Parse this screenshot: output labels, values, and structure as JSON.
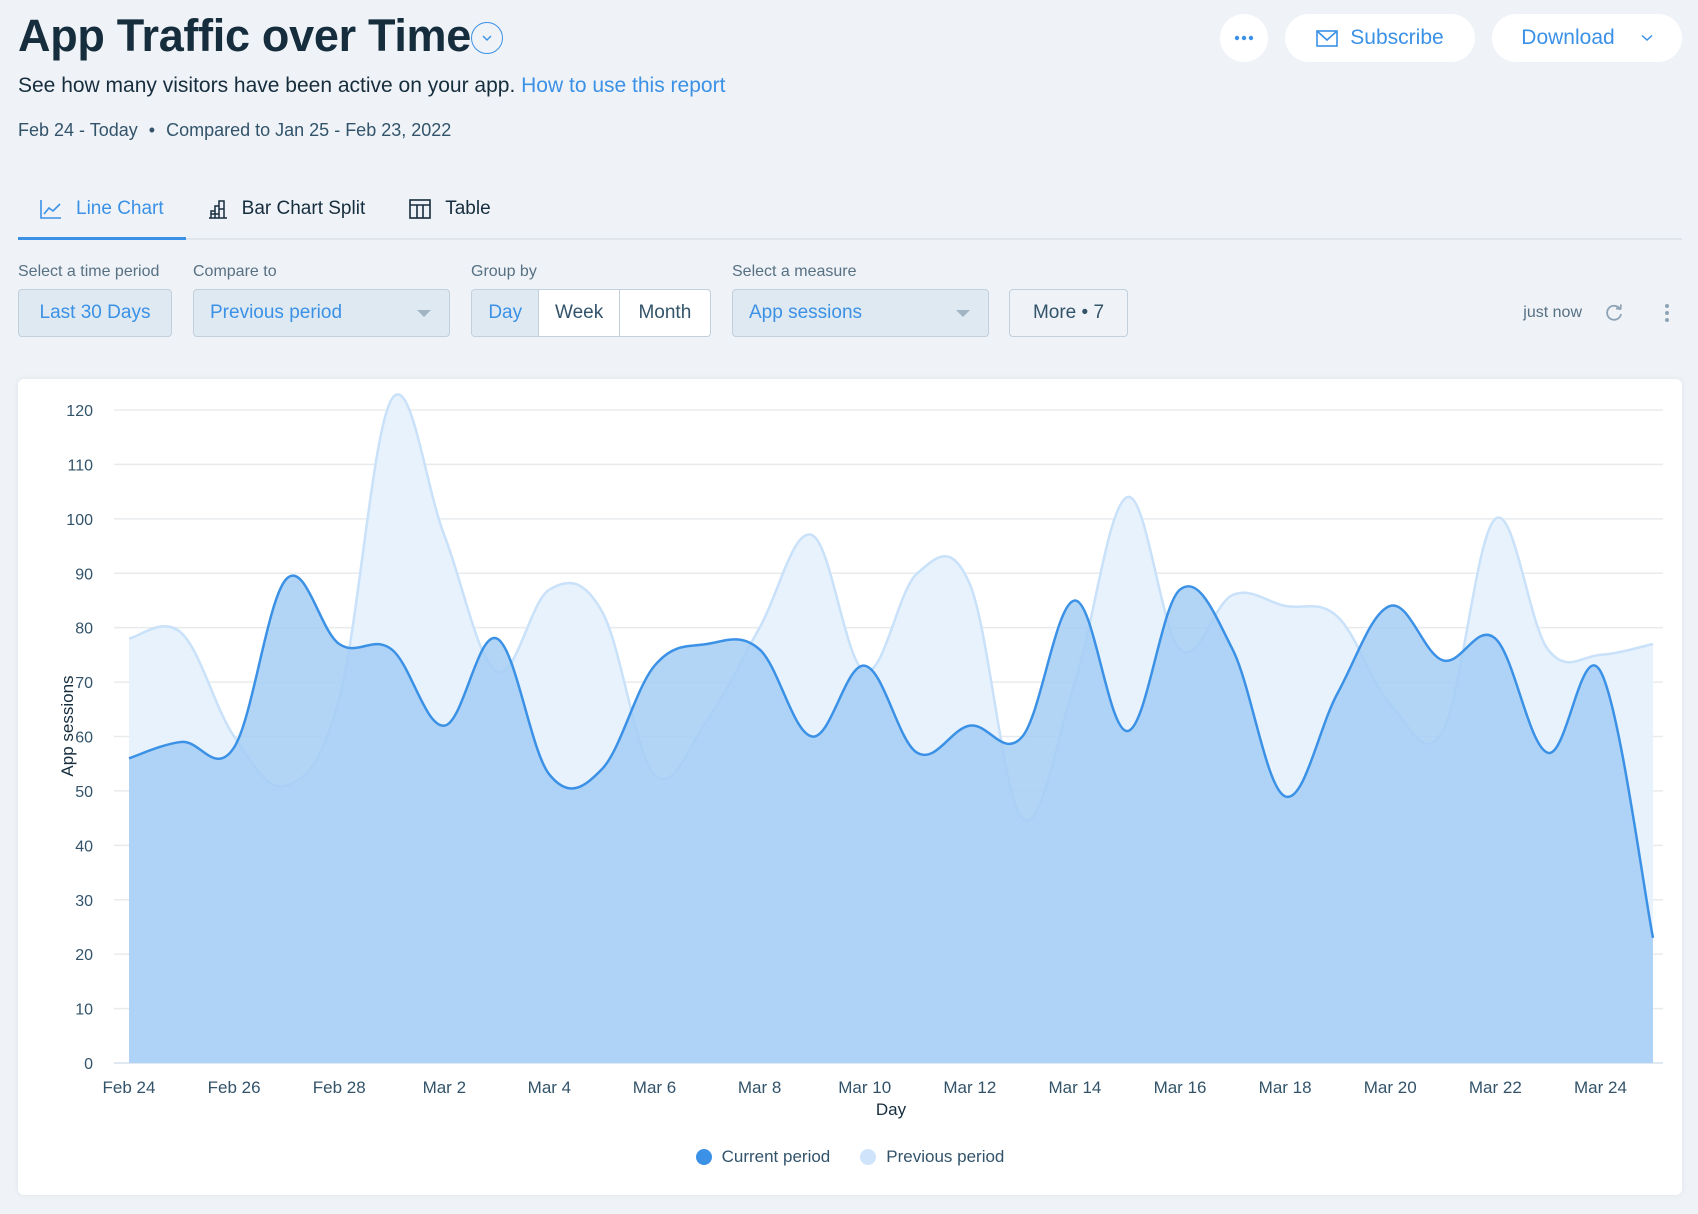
{
  "header": {
    "title": "App Traffic over Time",
    "subtitle": "See how many visitors have been active on your app.",
    "help_link": "How to use this report",
    "date_range": "Feb 24 - Today",
    "separator": "•",
    "compared_to": "Compared to Jan 25 - Feb 23, 2022"
  },
  "actions": {
    "more_label": "•••",
    "subscribe_label": "Subscribe",
    "download_label": "Download"
  },
  "tabs": [
    {
      "label": "Line Chart",
      "icon": "line-chart-icon",
      "active": true
    },
    {
      "label": "Bar Chart Split",
      "icon": "bar-chart-icon",
      "active": false
    },
    {
      "label": "Table",
      "icon": "table-icon",
      "active": false
    }
  ],
  "filters": {
    "time_period": {
      "label": "Select a time period",
      "value": "Last 30 Days"
    },
    "compare_to": {
      "label": "Compare to",
      "value": "Previous period"
    },
    "group_by": {
      "label": "Group by",
      "options": [
        "Day",
        "Week",
        "Month"
      ],
      "selected": "Day"
    },
    "measure": {
      "label": "Select a measure",
      "value": "App sessions"
    },
    "more": {
      "label": "More • 7"
    },
    "updated": "just now"
  },
  "colors": {
    "accent": "#3b91e6",
    "current_fill": "#a5cef5",
    "current_line": "#3b91e6",
    "previous_fill": "#e6f1fc",
    "previous_line": "#c9e1f9"
  },
  "chart_data": {
    "type": "area",
    "title": "",
    "xlabel": "Day",
    "ylabel": "App sessions",
    "ylim": [
      0,
      120
    ],
    "yticks": [
      0,
      10,
      20,
      30,
      40,
      50,
      60,
      70,
      80,
      90,
      100,
      110,
      120
    ],
    "grid": true,
    "legend_position": "bottom-center",
    "x": [
      "Feb 24",
      "Feb 25",
      "Feb 26",
      "Feb 27",
      "Feb 28",
      "Mar 1",
      "Mar 2",
      "Mar 3",
      "Mar 4",
      "Mar 5",
      "Mar 6",
      "Mar 7",
      "Mar 8",
      "Mar 9",
      "Mar 10",
      "Mar 11",
      "Mar 12",
      "Mar 13",
      "Mar 14",
      "Mar 15",
      "Mar 16",
      "Mar 17",
      "Mar 18",
      "Mar 19",
      "Mar 20",
      "Mar 21",
      "Mar 22",
      "Mar 23",
      "Mar 24",
      "Mar 25"
    ],
    "xtick_labels": [
      "Feb 24",
      "Feb 26",
      "Feb 28",
      "Mar 2",
      "Mar 4",
      "Mar 6",
      "Mar 8",
      "Mar 10",
      "Mar 12",
      "Mar 14",
      "Mar 16",
      "Mar 18",
      "Mar 20",
      "Mar 22",
      "Mar 24"
    ],
    "series": [
      {
        "name": "Previous period",
        "values": [
          78,
          79,
          60,
          51,
          67,
          122,
          97,
          72,
          87,
          83,
          53,
          63,
          80,
          97,
          72,
          90,
          88,
          45,
          70,
          104,
          76,
          86,
          84,
          82,
          66,
          61,
          100,
          76,
          75,
          77
        ]
      },
      {
        "name": "Current period",
        "values": [
          56,
          59,
          58,
          89,
          77,
          76,
          62,
          78,
          53,
          54,
          73,
          77,
          76,
          60,
          73,
          57,
          62,
          60,
          85,
          61,
          87,
          76,
          49,
          68,
          84,
          74,
          78,
          57,
          72,
          23
        ]
      }
    ]
  }
}
